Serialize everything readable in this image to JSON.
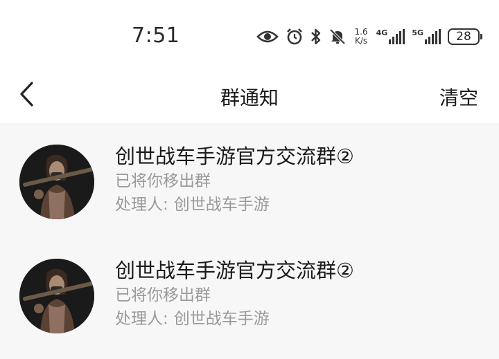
{
  "status_bar": {
    "time": "7:51",
    "net_speed_value": "1.6",
    "net_speed_unit": "K/s",
    "sim1_label": "4G",
    "sim2_label": "5G",
    "battery": "28",
    "icons": [
      "eye-icon",
      "alarm-icon",
      "bluetooth-icon",
      "mute-bell-icon"
    ]
  },
  "nav": {
    "back_icon": "chevron-left-icon",
    "title": "群通知",
    "clear_label": "清空"
  },
  "notifications": [
    {
      "group_name": "创世战车手游官方交流群②",
      "action": "已将你移出群",
      "handler_label": "处理人:",
      "handler_name": "创世战车手游"
    },
    {
      "group_name": "创世战车手游官方交流群②",
      "action": "已将你移出群",
      "handler_label": "处理人:",
      "handler_name": "创世战车手游"
    }
  ]
}
